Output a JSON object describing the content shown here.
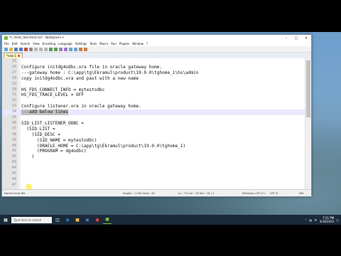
{
  "window": {
    "title": "*C:\\test_files\\test.txt - Notepad++"
  },
  "menu": [
    "File",
    "Edit",
    "Search",
    "View",
    "Encoding",
    "Language",
    "Settings",
    "Tools",
    "Macro",
    "Run",
    "Plugins",
    "Window",
    "?"
  ],
  "tab": {
    "label": "*new 1"
  },
  "editor": {
    "lines": [
      {
        "n": "25",
        "text": ""
      },
      {
        "n": "26",
        "text": "Configure initdg4odbc.ora file in oracle gateway home."
      },
      {
        "n": "27",
        "text": "---gateway home : C:\\app\\tg\\Ekramul\\product\\19.0.0\\tghome_1\\hs\\admin"
      },
      {
        "n": "28",
        "text": "copy initdg4odbc.ora and past with a new name"
      },
      {
        "n": "29",
        "text": ""
      },
      {
        "n": "30",
        "text": "HS_FDS_CONNECT_INFO = mytestodbc"
      },
      {
        "n": "31",
        "text": "HS_FDS_TRACE_LEVEL = OFF"
      },
      {
        "n": "32",
        "text": ""
      },
      {
        "n": "33",
        "text": "Configure listener.ora in oracle gateway home."
      },
      {
        "n": "34",
        "text": "---add below lines",
        "selected": true
      },
      {
        "n": "35",
        "text": ""
      },
      {
        "n": "36",
        "text": "SID_LIST_LISTENER_ODBC ="
      },
      {
        "n": "37",
        "text": "  (SID_LIST ="
      },
      {
        "n": "38",
        "text": "    (SID_DESC ="
      },
      {
        "n": "39",
        "text": "      (SID_NAME = mytestodbc)"
      },
      {
        "n": "40",
        "text": "      (ORACLE_HOME = C:\\app\\tg\\Ekramul\\product\\19.0.0\\tghome_1)"
      },
      {
        "n": "41",
        "text": "      (PROGRAM = dg4odbc)"
      },
      {
        "n": "42",
        "text": "    )"
      },
      {
        "n": "43",
        "text": ""
      },
      {
        "n": "44",
        "text": ""
      },
      {
        "n": "45",
        "text": ""
      },
      {
        "n": "46",
        "text": ""
      },
      {
        "n": "47",
        "text": ""
      }
    ]
  },
  "statusbar": {
    "type": "Normal text file",
    "length": "length : 1,094   lines : 61",
    "position": "Ln : 34   Col : 19   Sel : 18 | 1",
    "eol": "Windows (CR LF)",
    "encoding": "UTF-8",
    "mode": "INS"
  },
  "taskbar": {
    "search_placeholder": "Type here to search",
    "time": "7:21 PM",
    "date": "3/18/2022"
  },
  "colors": {
    "accent": "#7cba3b",
    "selection": "#c0c0c0",
    "current_line": "#e8e8ff"
  }
}
